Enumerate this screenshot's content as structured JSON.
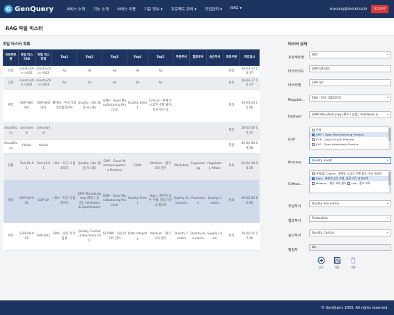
{
  "app": {
    "logo": "GenQuery",
    "nav": [
      "서비스 소개",
      "기능 소개",
      "서비스 이용",
      "기준 정보",
      "프로젝트 관리",
      "기업관리",
      "RAG"
    ],
    "user": "soyoung@rootel.co.kr",
    "logout": "로그아웃"
  },
  "page": {
    "title": "RAG 파일 마스터"
  },
  "list": {
    "title": "파일 마스터 목록",
    "columns": [
      "프로젝트명",
      "파일 마스터ID",
      "파일 마스터명",
      "Tag1",
      "Tag2",
      "Tag3",
      "Tag4",
      "Tag5",
      "주관부서",
      "협조부서",
      "승인부서",
      "처리구분",
      "처리일시"
    ],
    "rows": [
      {
        "style": "r-white",
        "cells": [
          "건성",
          "constructio n-002",
          "constructio n-002",
          "All",
          "All",
          "All",
          "All",
          "All",
          "",
          "",
          "",
          "처리",
          "26-03-17 10:37"
        ]
      },
      {
        "style": "r-gray",
        "cells": [
          "건설",
          "constructio n-001",
          "constructio n-001",
          "All",
          "All",
          "All",
          "All",
          "All",
          "",
          "",
          "",
          "처리",
          "26-03-17 10:37"
        ]
      },
      {
        "style": "r-white",
        "cells": [
          "제약",
          "SOP-SEO 001",
          "SOP-SEO 001",
          "MFDS - 한국 식품의약품안전처",
          "Quality / QA (품질 시스템)",
          "GMP - Good Manufacturing Practice",
          "Quality Event",
          "Critical - 위해 수 시 업무 수행 불가, 즉시 재구 성",
          "",
          "",
          "",
          "처리",
          "26-02-25 15:06"
        ]
      },
      {
        "style": "r-gray",
        "cells": [
          "SmartDocu",
          "unknownui",
          "unknownui",
          "",
          "",
          "",
          "",
          "",
          "",
          "",
          "",
          "처리",
          "26-02-20 14:21"
        ]
      },
      {
        "style": "r-white",
        "cells": [
          "SmartDocu",
          "follow",
          "follow",
          "",
          "",
          "",
          "",
          "",
          "",
          "",
          "",
          "처리",
          "26-02-20 09:58"
        ]
      },
      {
        "style": "r-gray",
        "cells": [
          "전월",
          "Test-01-01",
          "Test-01-01",
          "H1A - 미국 식 품의약국",
          "Quality / QA (품질 시스템)",
          "GMP - Good Pharmacovigilance Practice",
          "CAPA",
          "Medium - 평가 교육 필수",
          "Validation",
          "Engineering",
          "Regulatory Affairs",
          "처리",
          "26-02-19 04:39"
        ]
      },
      {
        "style": "r-blue",
        "cells": [
          "제약",
          "SOP-QA-001",
          "SOP QA",
          "H1A - 미국 식 품의약국",
          "GMP Manufacturing (제조 / 공정), Validation & Qualification",
          "GMP - Good Manufacturing Practice",
          "Quality Event",
          "High - 제한적 업무 수행, 일정 기간 내 재교육",
          "Quality Assurance",
          "Production",
          "Quality Control",
          "처리",
          "26-02-25 15:06"
        ]
      },
      {
        "style": "r-white",
        "cells": [
          "제약",
          "SOP-QA-002",
          "SOP-QA2",
          "EMA - 유럽 의 약품청",
          "Quality Control / Laboratory (QC)",
          "GCDMP - 임상 데이터 관리",
          "Data Integrity",
          "Medium - 평가 교육 필수",
          "Quality Control",
          "Quality Assurance",
          "Supply Chain",
          "처리",
          "26-02-11 17:46"
        ]
      }
    ]
  },
  "detail": {
    "title": "마스터 상세",
    "fields": {
      "project": {
        "label": "프로젝트명",
        "value": "제약"
      },
      "master_code": {
        "label": "마스터코드",
        "value": "SOP-QA-001"
      },
      "master_name": {
        "label": "마스터명",
        "value": "SOP QA"
      },
      "regulator": {
        "label": "Regulat...",
        "value": "FDA - 미국 식품의약국"
      },
      "domain": {
        "label": "Domain",
        "value": "GMP Manufacturing (제조 / 공정), Validation &"
      },
      "gxp": {
        "label": "GxP",
        "options": [
          {
            "text": "전체",
            "checked": false
          },
          {
            "text": "GMP - Good Manufacturing Practice",
            "checked": true
          },
          {
            "text": "GCP - Good Clinical Practice",
            "checked": false
          },
          {
            "text": "GLP - Good Laboratory Practice",
            "checked": false
          }
        ]
      },
      "process": {
        "label": "Process",
        "value": "Quality Event"
      },
      "criticality": {
        "label": "Critica...",
        "options": [
          {
            "text": "전체",
            "checked": false,
            "second": "Critical - 위해요 시 업무 수행 불가, 즉시 재교육"
          },
          {
            "text": "High - 제한적 업무 수행, 일정 기간 내 재교육",
            "checked": true,
            "second": ""
          },
          {
            "text": "Medium - 평가 교육 필수",
            "checked": false,
            "second": "Low - 참조 교육"
          }
        ]
      },
      "owner_dept": {
        "label": "주관부서",
        "value": "Quality Assurance"
      },
      "coop_dept": {
        "label": "협조부서",
        "value": "Production"
      },
      "approve_dept": {
        "label": "승인부서",
        "value": "Quality Control"
      },
      "processor": {
        "label": "확정자",
        "value": "Mn"
      }
    },
    "actions": {
      "new": "신규",
      "save": "저장",
      "delete": "삭제"
    }
  },
  "footer": {
    "text": "© GenQuery 2025. All rights reserved."
  },
  "colors": {
    "navy": "#1d3461",
    "logout": "#d93a3a",
    "selected_row": "#cfdaea"
  }
}
